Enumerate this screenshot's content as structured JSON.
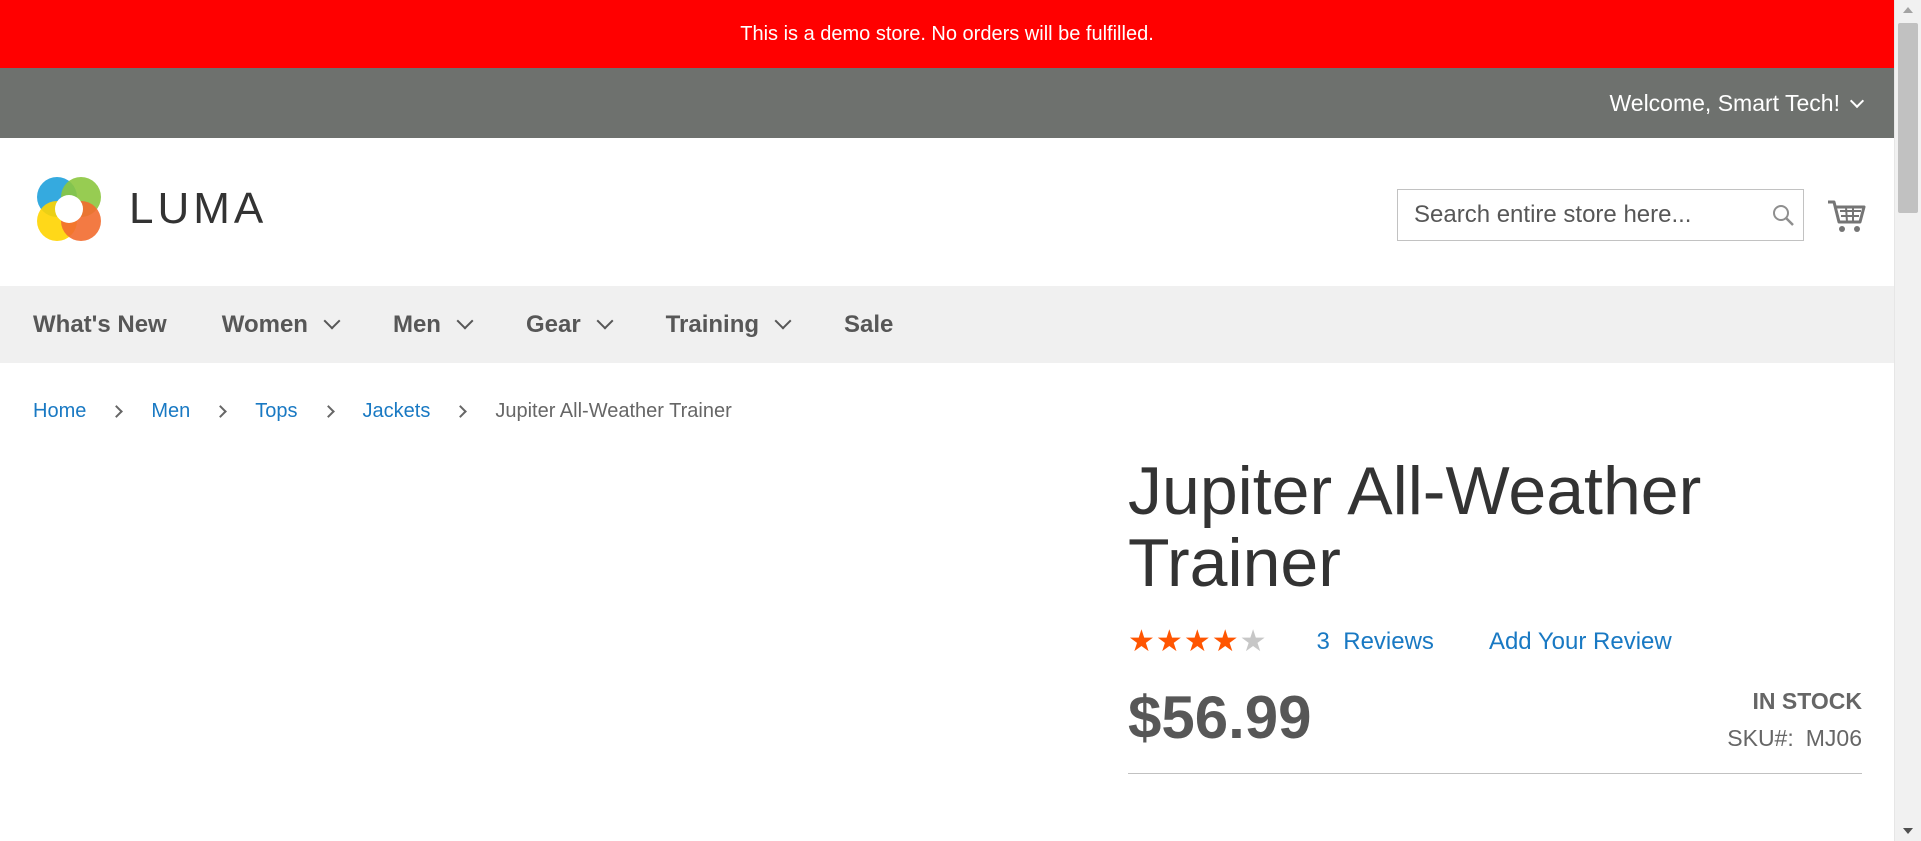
{
  "demo_notice": "This is a demo store. No orders will be fulfilled.",
  "top_panel": {
    "welcome": "Welcome, Smart Tech!"
  },
  "header": {
    "logo_text": "LUMA",
    "search_placeholder": "Search entire store here...",
    "icons": {
      "search": "search-icon",
      "cart": "cart-icon"
    }
  },
  "nav": {
    "items": [
      {
        "label": "What's New",
        "has_dropdown": false
      },
      {
        "label": "Women",
        "has_dropdown": true
      },
      {
        "label": "Men",
        "has_dropdown": true
      },
      {
        "label": "Gear",
        "has_dropdown": true
      },
      {
        "label": "Training",
        "has_dropdown": true
      },
      {
        "label": "Sale",
        "has_dropdown": false
      }
    ]
  },
  "breadcrumbs": {
    "items": [
      "Home",
      "Men",
      "Tops",
      "Jackets"
    ],
    "current": "Jupiter All-Weather Trainer"
  },
  "product": {
    "title_line1": "Jupiter All-Weather",
    "title_line2": "Trainer",
    "rating": 4,
    "rating_max": 5,
    "review_count": "3",
    "reviews_label": "Reviews",
    "add_review": "Add Your Review",
    "price": "$56.99",
    "stock_status": "In stock",
    "sku_label": "SKU#:",
    "sku": "MJ06"
  },
  "colors": {
    "demo_bar": "#ff0000",
    "top_panel": "#6e716e",
    "link": "#1979c3",
    "star_active": "#ff5501",
    "nav_bg": "#f0f0f0"
  }
}
